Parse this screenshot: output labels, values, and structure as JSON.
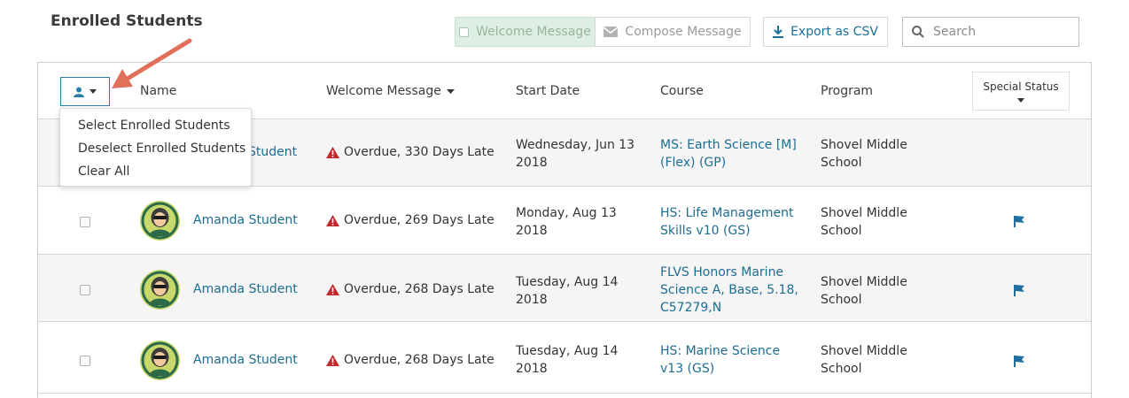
{
  "page_title": "Enrolled Students",
  "toolbar": {
    "welcome_label": "Welcome Message",
    "compose_label": "Compose Message",
    "export_label": "Export as CSV",
    "search_placeholder": "Search"
  },
  "columns": {
    "name": "Name",
    "welcome": "Welcome Message",
    "start_date": "Start Date",
    "course": "Course",
    "program": "Program",
    "special_status": "Special Status"
  },
  "dropdown": {
    "items": [
      "Select Enrolled Students",
      "Deselect Enrolled Students",
      "Clear All"
    ]
  },
  "rows": [
    {
      "name": "Amanda Student",
      "visible_name": "Student",
      "welcome": "Overdue, 330 Days Late",
      "date_line1": "Wednesday, Jun 13",
      "date_line2": "2018",
      "course_line1": "MS: Earth Science [M]",
      "course_line2": "(Flex) (GP)",
      "course_line3": "",
      "program_line1": "Shovel Middle",
      "program_line2": "School",
      "flagged": false
    },
    {
      "name": "Amanda Student",
      "welcome": "Overdue, 269 Days Late",
      "date_line1": "Monday, Aug 13",
      "date_line2": "2018",
      "course_line1": "HS: Life Management",
      "course_line2": "Skills v10 (GS)",
      "course_line3": "",
      "program_line1": "Shovel Middle",
      "program_line2": "School",
      "flagged": true
    },
    {
      "name": "Amanda Student",
      "welcome": "Overdue, 268 Days Late",
      "date_line1": "Tuesday, Aug 14",
      "date_line2": "2018",
      "course_line1": "FLVS Honors Marine",
      "course_line2": "Science A, Base, 5.18,",
      "course_line3": "C57279,N",
      "program_line1": "Shovel Middle",
      "program_line2": "School",
      "flagged": true
    },
    {
      "name": "Amanda Student",
      "welcome": "Overdue, 268 Days Late",
      "date_line1": "Tuesday, Aug 14",
      "date_line2": "2018",
      "course_line1": "HS: Marine Science",
      "course_line2": "v13 (GS)",
      "course_line3": "",
      "program_line1": "Shovel Middle",
      "program_line2": "School",
      "flagged": true
    }
  ],
  "colors": {
    "link": "#1d6d92",
    "accent_arrow": "#e0705a",
    "warning": "#c0282d",
    "flag": "#1f6fa0"
  }
}
